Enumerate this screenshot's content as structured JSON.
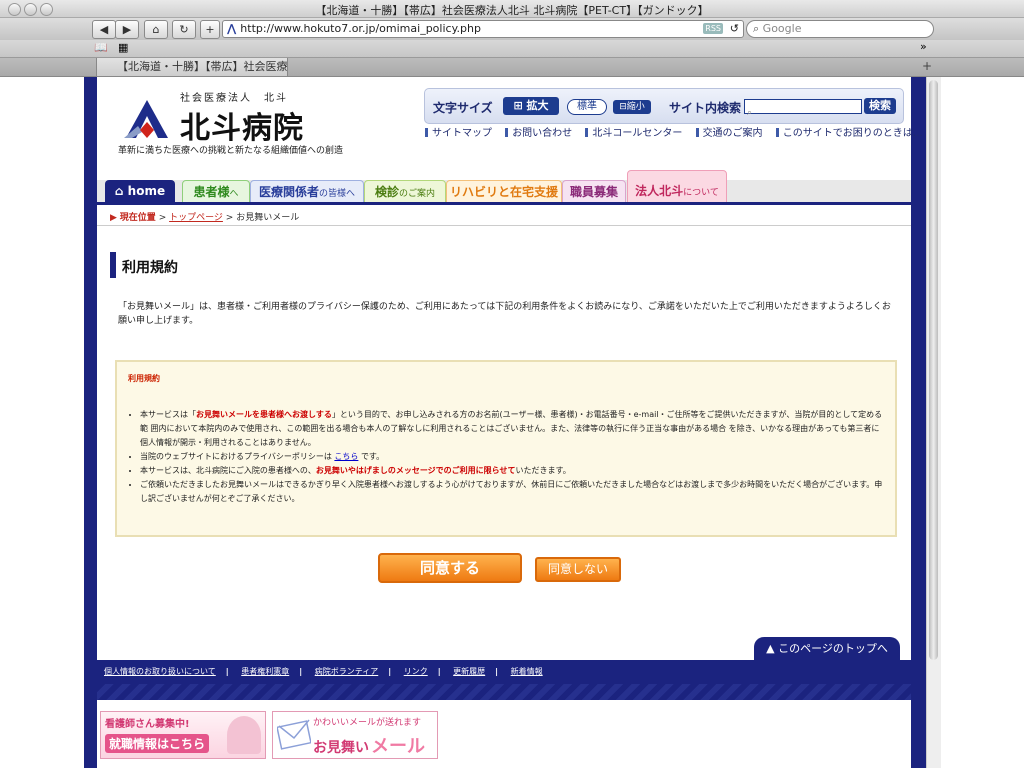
{
  "browser": {
    "window_title": "【北海道・十勝】【帯広】社会医療法人北斗 北斗病院【PET-CT】【ガンドック】",
    "url": "http://www.hokuto7.or.jp/omimai_policy.php",
    "search_placeholder": "Google",
    "rss_label": "RSS",
    "tab_title": "【北海道・十勝】【帯広】社会医療法…"
  },
  "header": {
    "org_small": "社会医療法人　北斗",
    "org_name": "北斗病院",
    "tagline": "革新に満ちた医療への挑戦と新たなる組織価値への創造",
    "font_size_label": "文字サイズ",
    "enlarge": "拡大",
    "standard": "標準",
    "shrink": "縮小",
    "site_search_label": "サイト内検索",
    "search_button": "検索",
    "links": [
      "サイトマップ",
      "お問い合わせ",
      "北斗コールセンター",
      "交通のご案内",
      "このサイトでお困りのときは…"
    ]
  },
  "nav": {
    "home": "home",
    "patients": "患者様",
    "patients_suffix": "へ",
    "medical": "医療関係者",
    "medical_suffix": "の皆様へ",
    "checkup": "検診",
    "checkup_suffix": "のご案内",
    "rehab": "リハビリと在宅支援",
    "recruit": "職員募集",
    "corp": "法人北斗",
    "corp_suffix": "について"
  },
  "breadcrumb": {
    "label": "現在位置",
    "top": "トップページ",
    "current": "お見舞いメール"
  },
  "content": {
    "title": "利用規約",
    "intro": "「お見舞いメール」は、患者様・ご利用者様のプライバシー保護のため、ご利用にあたっては下記の利用条件をよくお読みになり、ご承諾をいただいた上でご利用いただきますようよろしくお願い申し上げます。",
    "terms_title": "利用規約",
    "t1_a": "本サービスは「",
    "t1_b": "お見舞いメールを患者様へお渡しする",
    "t1_c": "」という目的で、お申し込みされる方のお名前(ユーザー様、患者様)・お電話番号・e-mail・ご住所等をご提供いただきますが、当院が目的として定める範 囲内において本院内のみで使用され、この範囲を出る場合も本人の了解なしに利用されることはございません。また、法律等の執行に伴う正当な事由がある場合 を除き、いかなる理由があっても第三者に個人情報が開示・利用されることはありません。",
    "t2_a": "当院のウェブサイトにおけるプライバシーポリシーは",
    "t2_link": "こちら",
    "t2_b": "です。",
    "t3_a": "本サービスは、北斗病院にご入院の患者様への、",
    "t3_b": "お見舞いやはげましのメッセージでのご利用に限らせて",
    "t3_c": "いただきます。",
    "t4": "ご依頼いただきましたお見舞いメールはできるかぎり早く入院患者様へお渡しするよう心がけておりますが、休前日にご依頼いただきました場合などはお渡しまで多少お時間をいただく場合がございます。申し訳ございませんが何とぞご了承ください。",
    "agree": "同意する",
    "disagree": "同意しない"
  },
  "footer": {
    "pagetop": "▲ このページのトップへ",
    "links": [
      "個人情報のお取り扱いについて",
      "患者権利憲章",
      "病院ボランティア",
      "リンク",
      "更新履歴",
      "新着情報"
    ],
    "banner1_top": "看護師さん募集中!",
    "banner1_bottom": "就職情報はこちら",
    "banner2_top": "かわいいメールが送れます",
    "banner2_bottom": "お見舞い",
    "banner2_bottom2": "メール"
  },
  "colors": {
    "navy": "#1b237f",
    "orange": "#ee7a12",
    "terms_bg": "#fdf9e6"
  }
}
